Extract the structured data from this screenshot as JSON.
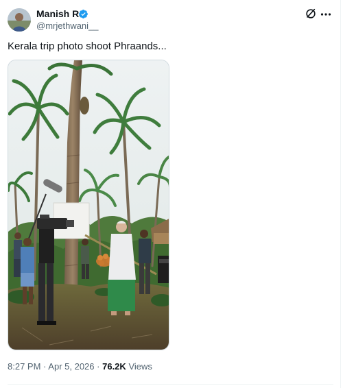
{
  "author": {
    "display_name": "Manish RJ",
    "handle": "@mrjethwani__",
    "verified": true
  },
  "post": {
    "text": "Kerala trip photo shoot Phraands...",
    "time": "8:27 PM",
    "separator": "·",
    "date": "Apr 5, 2026",
    "views_count": "76.2K",
    "views_label": "Views"
  },
  "icons": {
    "verified": "verified-badge-icon",
    "grok": "grok-icon",
    "more": "more-options-icon"
  },
  "colors": {
    "verified_blue": "#1d9bf0",
    "text_primary": "#0f1419",
    "text_secondary": "#536471",
    "border": "#cfd9de"
  }
}
